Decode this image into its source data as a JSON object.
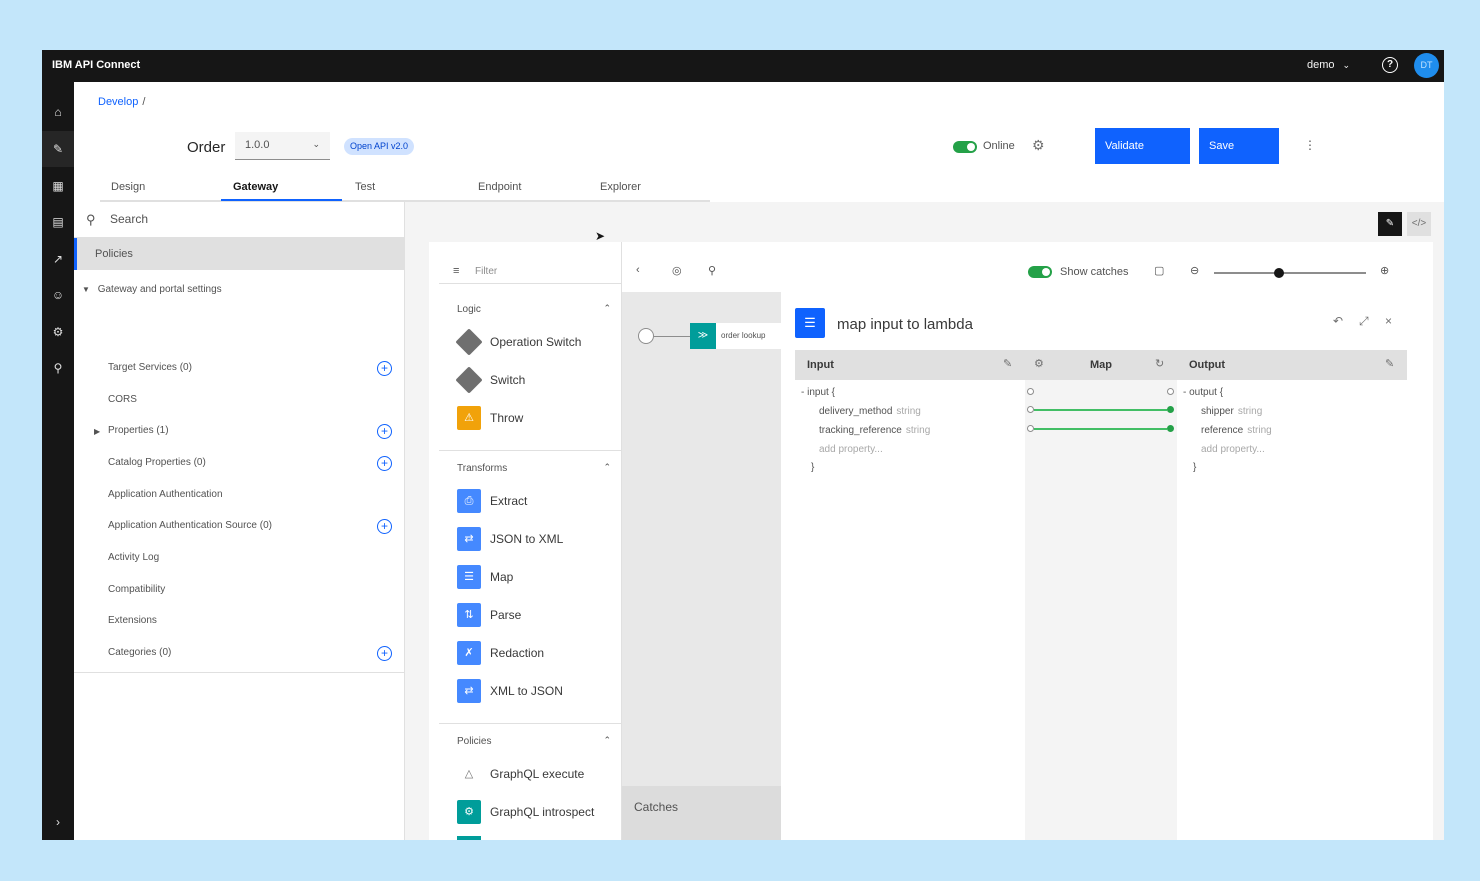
{
  "app": {
    "brand": "IBM API Connect",
    "user": "demo",
    "avatar_initials": "DT"
  },
  "icons": {
    "help": "help-icon",
    "nav": [
      "home-icon",
      "develop-icon",
      "apps-icon",
      "catalog-icon",
      "analytics-icon",
      "users-icon",
      "settings-icon",
      "search-icon"
    ]
  },
  "breadcrumb": {
    "root": "Develop",
    "sep": "/"
  },
  "header": {
    "api_name": "Order",
    "version": "1.0.0",
    "spec_tag": "Open API v2.0",
    "online_label": "Online",
    "validate_label": "Validate",
    "save_label": "Save",
    "overflow": "⋮"
  },
  "tabs": [
    {
      "label": "Design"
    },
    {
      "label": "Gateway",
      "active": true
    },
    {
      "label": "Test"
    },
    {
      "label": "Endpoint"
    },
    {
      "label": "Explorer"
    }
  ],
  "sidebar": {
    "search_placeholder": "Search",
    "policies": "Policies",
    "group": "Gateway and portal settings",
    "items": [
      {
        "label": "Target Services (0)",
        "addable": true
      },
      {
        "label": "CORS"
      },
      {
        "label": "Properties (1)",
        "addable": true,
        "expandable": true
      },
      {
        "label": "Catalog Properties (0)",
        "addable": true
      },
      {
        "label": "Application Authentication"
      },
      {
        "label": "Application Authentication Source (0)",
        "addable": true
      },
      {
        "label": "Activity Log"
      },
      {
        "label": "Compatibility"
      },
      {
        "label": "Extensions"
      },
      {
        "label": "Categories (0)",
        "addable": true
      }
    ]
  },
  "palette": {
    "filter_placeholder": "Filter",
    "sections": [
      {
        "title": "Logic",
        "items": [
          "Operation Switch",
          "Switch",
          "Throw"
        ]
      },
      {
        "title": "Transforms",
        "items": [
          "Extract",
          "JSON to XML",
          "Map",
          "Parse",
          "Redaction",
          "XML to JSON"
        ]
      },
      {
        "title": "Policies",
        "items": [
          "GraphQL execute",
          "GraphQL introspect"
        ]
      }
    ]
  },
  "flow": {
    "node_label": "order lookup",
    "catches_label": "Catches",
    "show_catches_label": "Show catches",
    "zoom_fraction": 0.43
  },
  "editor": {
    "title": "map input to lambda",
    "input_label": "Input",
    "map_label": "Map",
    "output_label": "Output",
    "input_root": "input {",
    "output_root": "output {",
    "close_brace": "}",
    "add_property": "add property...",
    "input_fields": [
      {
        "name": "delivery_method",
        "type": "string"
      },
      {
        "name": "tracking_reference",
        "type": "string"
      }
    ],
    "output_fields": [
      {
        "name": "shipper",
        "type": "string"
      },
      {
        "name": "reference",
        "type": "string"
      }
    ]
  },
  "colors": {
    "primary": "#0f62fe",
    "success": "#24a148",
    "teal": "#009d9a",
    "warning": "#f1a20a",
    "topbar": "#161616"
  }
}
